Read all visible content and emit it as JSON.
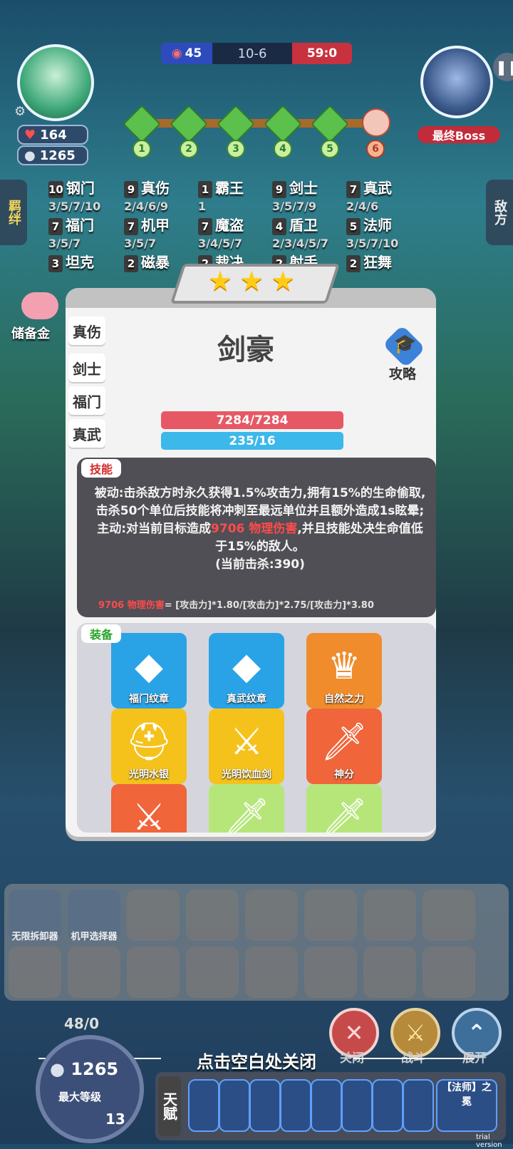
{
  "hud": {
    "hearts": "164",
    "coins": "1265",
    "ally_score": "45",
    "stage": "10-6",
    "enemy_score": "59:0",
    "boss_label": "最终Boss",
    "stage_nodes": [
      "1",
      "2",
      "3",
      "4",
      "5",
      "6"
    ]
  },
  "side_tabs": {
    "left": "羁绊",
    "right": "敌方"
  },
  "synergies": [
    {
      "count": "10",
      "name": "钢门",
      "tiers": "3/5/7/10"
    },
    {
      "count": "9",
      "name": "真伤",
      "tiers": "2/4/6/9"
    },
    {
      "count": "1",
      "name": "霸王",
      "tiers": "1"
    },
    {
      "count": "9",
      "name": "剑士",
      "tiers": "3/5/7/9"
    },
    {
      "count": "7",
      "name": "真武",
      "tiers": "2/4/6"
    },
    {
      "count": "7",
      "name": "福门",
      "tiers": "3/5/7"
    },
    {
      "count": "7",
      "name": "机甲",
      "tiers": "3/5/7"
    },
    {
      "count": "7",
      "name": "魔盗",
      "tiers": "3/4/5/7"
    },
    {
      "count": "4",
      "name": "盾卫",
      "tiers": "2/3/4/5/7"
    },
    {
      "count": "5",
      "name": "法师",
      "tiers": "3/5/7/10"
    },
    {
      "count": "3",
      "name": "坦克",
      "tiers": ""
    },
    {
      "count": "2",
      "name": "磁暴",
      "tiers": ""
    },
    {
      "count": "2",
      "name": "裁决",
      "tiers": ""
    },
    {
      "count": "2",
      "name": "射手",
      "tiers": ""
    },
    {
      "count": "2",
      "name": "狂舞",
      "tiers": ""
    }
  ],
  "piggy_bank": "储备金",
  "modal": {
    "stars": [
      "★",
      "★",
      "★"
    ],
    "hero_name": "剑豪",
    "guide_label": "攻略",
    "tabs": [
      "真伤",
      "剑士",
      "福门",
      "真武"
    ],
    "hp": "7284/7284",
    "mp": "235/16",
    "skill_label": "技能",
    "skill_passive": "被动:击杀敌方时永久获得1.5%攻击力,拥有15%的生命偷取,击杀50个单位后技能将冲刺至最远单位并且额外造成1s眩晕;",
    "skill_active_prefix": "主动:对当前目标造成",
    "skill_active_damage": "9706 物理伤害",
    "skill_active_suffix": ",并且技能处决生命值低于15%的敌人。",
    "skill_kills": "(当前击杀:390)",
    "formula_damage": "9706 物理伤害",
    "formula_rest": "= [攻击力]*1.80/[攻击力]*2.75/[攻击力]*3.80",
    "equip_label": "装备",
    "equipment": [
      {
        "name": "福门纹章",
        "icon": "◆",
        "bg": "#2aa3e6"
      },
      {
        "name": "真武纹章",
        "icon": "◆",
        "bg": "#2aa3e6"
      },
      {
        "name": "自然之力",
        "icon": "♛",
        "bg": "#f08c2c"
      },
      {
        "name": "光明水银",
        "icon": "⛑",
        "bg": "#f5c21c"
      },
      {
        "name": "光明饮血剑",
        "icon": "⚔",
        "bg": "#f5c21c"
      },
      {
        "name": "神分",
        "icon": "🗡",
        "bg": "#f0653a"
      },
      {
        "name": "",
        "icon": "⚔",
        "bg": "#f0653a"
      },
      {
        "name": "",
        "icon": "🗡",
        "bg": "#b6e67a"
      },
      {
        "name": "",
        "icon": "🗡",
        "bg": "#b6e67a"
      }
    ]
  },
  "bench": {
    "slots": [
      "无限拆卸器",
      "机甲选择器"
    ]
  },
  "controls": {
    "close": "关闭",
    "battle": "战斗",
    "expand": "展开",
    "close_hint": "点击空白处关闭"
  },
  "player": {
    "xp": "48/0",
    "gold": "1265",
    "level_label": "最大等级",
    "level": "13"
  },
  "talent": {
    "label": "天赋",
    "last_card": "【法师】之冕"
  },
  "watermark": "trial version"
}
